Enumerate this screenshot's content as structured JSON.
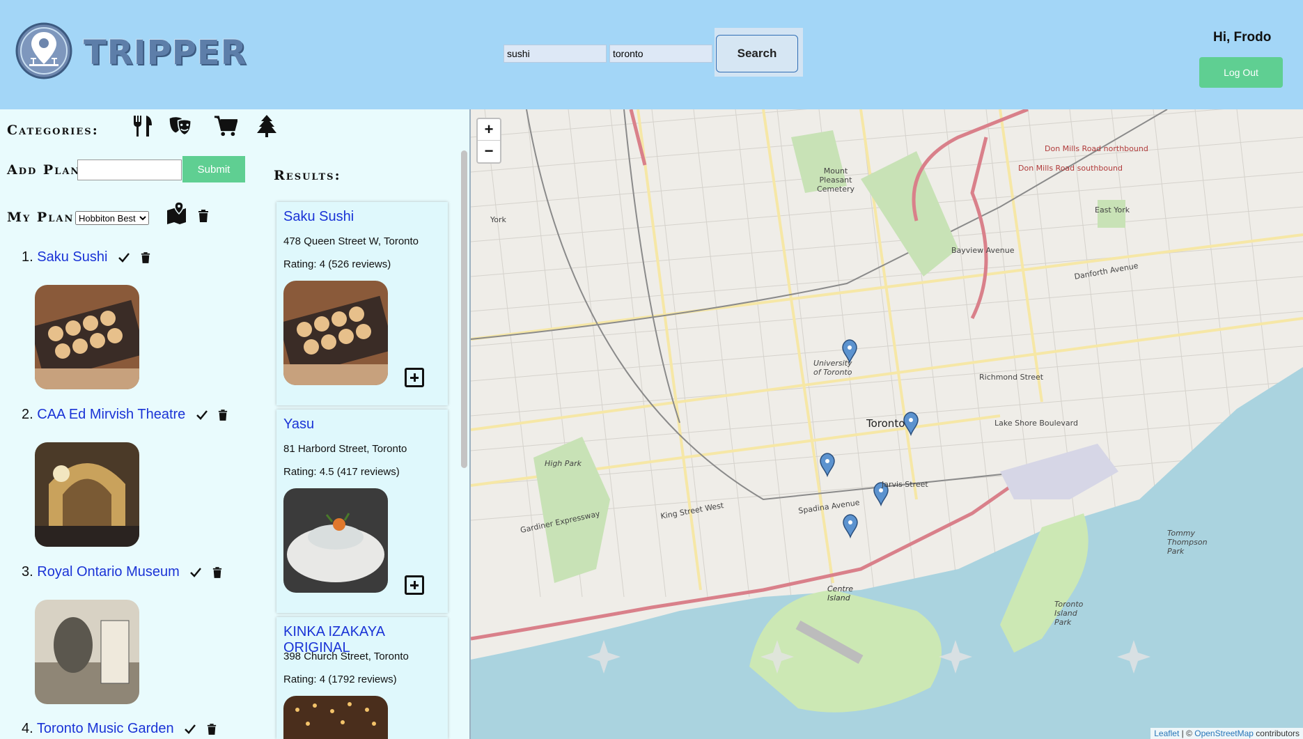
{
  "header": {
    "brand": "TRIPPER",
    "search_term": "sushi",
    "search_location": "toronto",
    "search_label": "Search",
    "greeting": "Hi, Frodo",
    "logout_label": "Log Out"
  },
  "sidebar": {
    "categories_label": "Categories:",
    "category_icons": [
      "restaurant-icon",
      "theatre-icon",
      "shopping-cart-icon",
      "tree-icon"
    ],
    "add_plan_label": "Add Plan:",
    "submit_label": "Submit",
    "my_plan_label": "My Plan:",
    "selected_plan": "Hobbiton Best",
    "plan_items": [
      {
        "num": "1.",
        "name": "Saku Sushi"
      },
      {
        "num": "2.",
        "name": "CAA Ed Mirvish Theatre"
      },
      {
        "num": "3.",
        "name": "Royal Ontario Museum"
      },
      {
        "num": "4.",
        "name": "Toronto Music Garden"
      }
    ]
  },
  "results": {
    "label": "Results:",
    "items": [
      {
        "name": "Saku Sushi",
        "address": "478 Queen Street W, Toronto",
        "rating": "Rating: 4 (526 reviews)"
      },
      {
        "name": "Yasu",
        "address": "81 Harbord Street, Toronto",
        "rating": "Rating: 4.5 (417 reviews)"
      },
      {
        "name": "KINKA IZAKAYA ORIGINAL",
        "address": "398 Church Street, Toronto",
        "rating": "Rating: 4 (1792 reviews)"
      }
    ]
  },
  "map": {
    "zoom_in": "+",
    "zoom_out": "−",
    "labels": [
      "Toronto",
      "York",
      "East York",
      "University of Toronto",
      "Centre Island",
      "Mount Pleasant Cemetery",
      "High Park",
      "Tommy Thompson Park",
      "Toronto Island Park",
      "Don Mills Road northbound",
      "Don Mills Road southbound",
      "Danforth Avenue",
      "Gardiner Expressway",
      "Lake Shore Boulevard",
      "Richmond Street",
      "Spadina Avenue",
      "Jarvis Street",
      "King Street West",
      "Bayview Avenue"
    ],
    "attribution_leaflet": "Leaflet",
    "attribution_sep": " | © ",
    "attribution_osm": "OpenStreetMap",
    "attribution_tail": " contributors"
  }
}
